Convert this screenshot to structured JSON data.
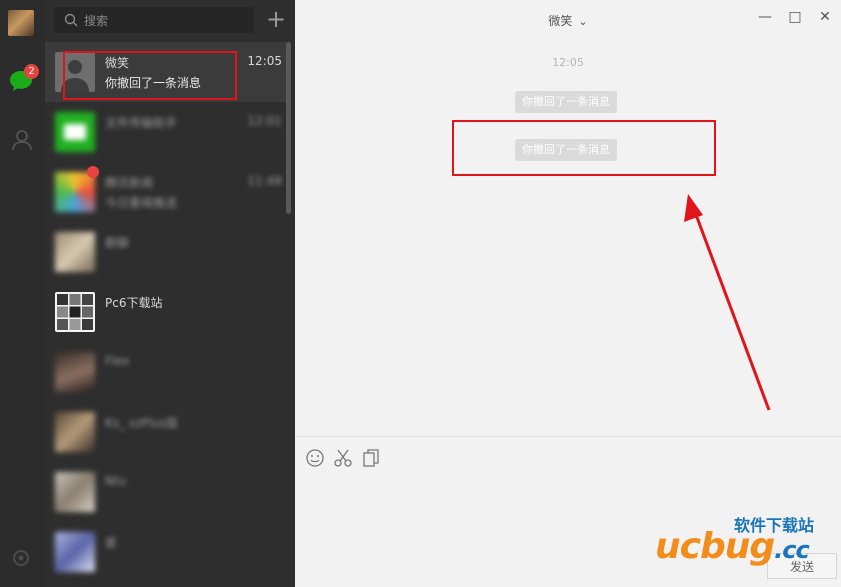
{
  "rail": {
    "unread_count": "2"
  },
  "search": {
    "placeholder": "搜索",
    "add_label": "+"
  },
  "conversations": [
    {
      "name": "微笑",
      "message": "你撤回了一条消息",
      "time": "12:05"
    },
    {
      "name": "文件传输助手",
      "message": "",
      "time": "12:01"
    },
    {
      "name": "腾讯新闻",
      "message": "今日要闻推送",
      "time": "11:48"
    },
    {
      "name": "群聊",
      "message": "",
      "time": ""
    },
    {
      "name": "Pc6下载站",
      "message": "",
      "time": ""
    },
    {
      "name": "Flex",
      "message": "",
      "time": ""
    },
    {
      "name": "Ks_ szPlus版",
      "message": "",
      "time": ""
    },
    {
      "name": "Ntu",
      "message": "",
      "time": ""
    },
    {
      "name": "家",
      "message": "",
      "time": ""
    }
  ],
  "chat": {
    "title": "微笑",
    "time_label": "12:05",
    "system_messages": [
      "你撤回了一条消息",
      "你撤回了一条消息"
    ],
    "send_label": "发送"
  },
  "watermark": {
    "top": "软件下载站",
    "main": "ucbug",
    "suffix": ".cc"
  },
  "colors": {
    "highlight": "#e0141a",
    "badge": "#e64340",
    "wechat_green": "#1aad19"
  }
}
